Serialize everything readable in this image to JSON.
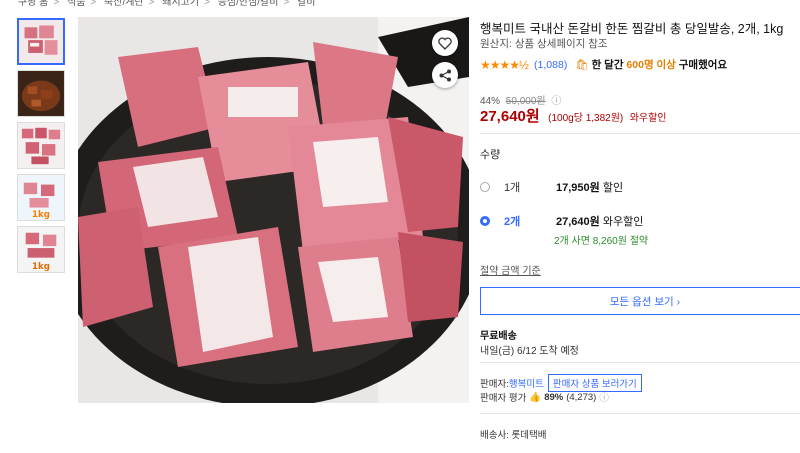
{
  "breadcrumb": [
    "쿠팡 홈",
    "식품",
    "축산/계란",
    "돼지고기",
    "등심/안심/갈비",
    "갈비"
  ],
  "thumbnails": [
    {
      "label": ""
    },
    {
      "label": ""
    },
    {
      "label": ""
    },
    {
      "label": "1kg"
    },
    {
      "label": "1kg"
    }
  ],
  "product": {
    "title": "행복미트 국내산 돈갈비 한돈 찜갈비 총 당일발송, 2개, 1kg",
    "origin": "원산지: 상품 상세페이지 참조",
    "stars": "★★★★½",
    "rating_value": 4.5,
    "reviews": "(1,088)",
    "sold_prefix": "한 달간",
    "sold_count": "600명 이상",
    "sold_suffix": "구매했어요"
  },
  "pricing": {
    "discount": "44%",
    "original": "50,000원",
    "price": "27,640원",
    "unit_price": "(100g당 1,382원)",
    "wow": "와우할인"
  },
  "quantity": {
    "label": "수량",
    "options": [
      {
        "name": "1개",
        "price": "17,950원",
        "tag": "할인"
      },
      {
        "name": "2개",
        "price": "27,640원",
        "tag": "와우할인",
        "sub": "2개 사면 8,260원 절약"
      }
    ]
  },
  "compare_link": "절약 금액 기준",
  "all_options": "모든 옵션 보기 ›",
  "shipping": {
    "title": "무료배송",
    "date": "내일(금) 6/12 도착 예정"
  },
  "seller": {
    "label": "판매자:",
    "name": "행복미트",
    "bubble": "판매자 상품 보러가기",
    "rating_label": "판매자 평가",
    "rating_pct": "89%",
    "rating_count": "(4,273)"
  },
  "courier": "배송사: 롯데택배",
  "colors": {
    "accent": "#346aff",
    "price": "#ae0000",
    "star": "#ff8a00",
    "green": "#2a8a2a"
  }
}
